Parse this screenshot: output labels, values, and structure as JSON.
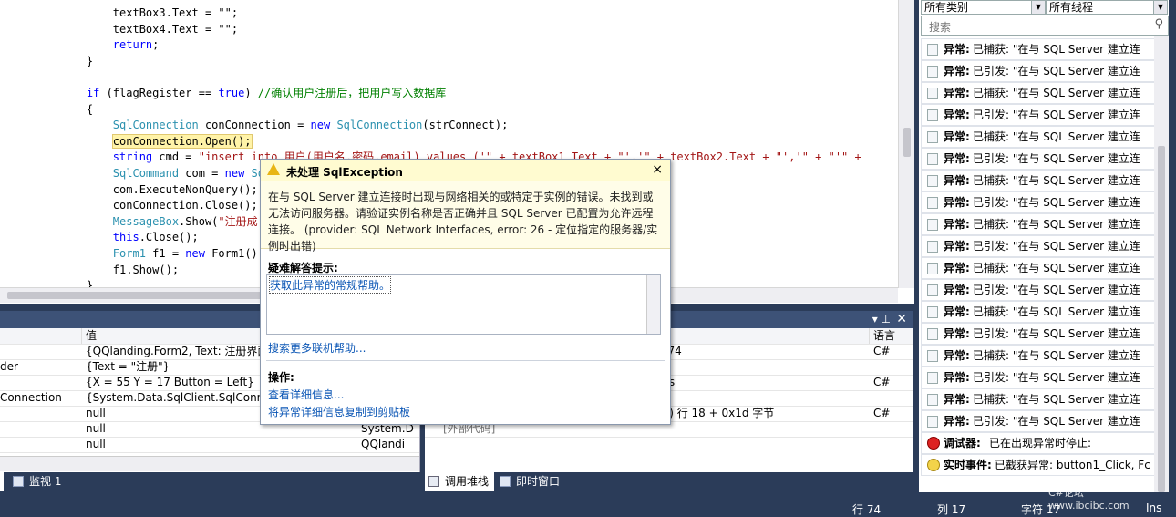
{
  "code": {
    "lines": [
      {
        "indent": "        ",
        "text": "textBox3.Text = \"\";"
      },
      {
        "indent": "        ",
        "text": "textBox4.Text = \"\";"
      },
      {
        "indent": "        ",
        "kw": "return",
        "text": ";"
      },
      {
        "indent": "    ",
        "text": "}"
      },
      {
        "indent": "",
        "text": ""
      },
      {
        "indent": "    ",
        "kw": "if",
        "text": " (flagRegister == ",
        "kw2": "true",
        "text2": ") ",
        "comment": "//确认用户注册后，把用户写入数据库"
      },
      {
        "indent": "    ",
        "text": "{"
      },
      {
        "indent": "        ",
        "type": "SqlConnection",
        "text": " conConnection = ",
        "kw": "new",
        "type2": " SqlConnection",
        "text2": "(strConnect);"
      },
      {
        "indent": "        ",
        "highlight": "conConnection.Open();",
        "text": ""
      },
      {
        "indent": "        ",
        "kw": "string",
        "text": " cmd = ",
        "str": "\"insert into 用户(用户名,密码,email) values ('\" + textBox1.Text + \"','\" + textBox2.Text + \"','\" + \"'\" +"
      },
      {
        "indent": "        ",
        "type": "SqlCommand",
        "text": " com = ",
        "kw": "new",
        "type2": " Sq"
      },
      {
        "indent": "        ",
        "text": "com.ExecuteNonQuery();"
      },
      {
        "indent": "        ",
        "text": "conConnection.Close();"
      },
      {
        "indent": "        ",
        "type": "MessageBox",
        "text": ".Show(",
        "str": "\"注册成"
      },
      {
        "indent": "        ",
        "kw": "this",
        "text": ".Close();"
      },
      {
        "indent": "        ",
        "type": "Form1",
        "text": " f1 = ",
        "kw": "new",
        "text2": " Form1()"
      },
      {
        "indent": "        ",
        "text": "f1.Show();"
      },
      {
        "indent": "    ",
        "text": "}"
      }
    ]
  },
  "watch": {
    "header_value": "值",
    "rows": [
      {
        "name": "",
        "value": "{QQlanding.Form2, Text: 注册界面}",
        "type": ""
      },
      {
        "name": "der",
        "value": "{Text = \"注册\"}",
        "type": ""
      },
      {
        "name": "",
        "value": "{X = 55 Y = 17 Button = Left}",
        "type": ""
      },
      {
        "name": "Connection",
        "value": "{System.Data.SqlClient.SqlConnection}",
        "type": ""
      },
      {
        "name": "",
        "value": "null",
        "type": "string"
      },
      {
        "name": "",
        "value": "null",
        "type": "System.D"
      },
      {
        "name": "",
        "value": "null",
        "type": "QQlandi"
      }
    ],
    "tab_label": "监视 1"
  },
  "callstack": {
    "header_lang": "语言",
    "rows": [
      {
        "text": "k(object sender, System.EventArgs e) 行 74",
        "lang": "C#"
      },
      {
        "text": "",
        "lang": ""
      },
      {
        "text": "nkClicked(object sender, System.Windows",
        "lang": "C#"
      },
      {
        "text": "",
        "lang": ""
      },
      {
        "text": "QQlanding.exe!QQlanding.Program.Main() 行 18 + 0x1d 字节",
        "lang": "C#"
      },
      {
        "text": "[外部代码]",
        "lang": ""
      }
    ],
    "tabs": [
      "调用堆栈",
      "即时窗口"
    ]
  },
  "dialog": {
    "title": "未处理 SqlException",
    "close": "×",
    "message": "在与 SQL Server 建立连接时出现与网络相关的或特定于实例的错误。未找到或无法访问服务器。请验证实例名称是否正确并且 SQL Server 已配置为允许远程连接。 (provider: SQL Network Interfaces, error: 26 - 定位指定的服务器/实例时出错)",
    "tips_title": "疑难解答提示:",
    "tip_link": "获取此异常的常规帮助。",
    "search_link": "搜索更多联机帮助...",
    "actions_title": "操作:",
    "action_details": "查看详细信息...",
    "action_copy": "将异常详细信息复制到剪贴板"
  },
  "events": {
    "filter_category": "所有类别",
    "filter_thread": "所有线程",
    "search_placeholder": "搜索",
    "rows": [
      {
        "label": "异常:",
        "text": "已捕获: \"在与 SQL Server 建立连"
      },
      {
        "label": "异常:",
        "text": "已引发: \"在与 SQL Server 建立连"
      },
      {
        "label": "异常:",
        "text": "已捕获: \"在与 SQL Server 建立连"
      },
      {
        "label": "异常:",
        "text": "已引发: \"在与 SQL Server 建立连"
      },
      {
        "label": "异常:",
        "text": "已捕获: \"在与 SQL Server 建立连"
      },
      {
        "label": "异常:",
        "text": "已引发: \"在与 SQL Server 建立连"
      },
      {
        "label": "异常:",
        "text": "已捕获: \"在与 SQL Server 建立连"
      },
      {
        "label": "异常:",
        "text": "已引发: \"在与 SQL Server 建立连"
      },
      {
        "label": "异常:",
        "text": "已捕获: \"在与 SQL Server 建立连"
      },
      {
        "label": "异常:",
        "text": "已引发: \"在与 SQL Server 建立连"
      },
      {
        "label": "异常:",
        "text": "已捕获: \"在与 SQL Server 建立连"
      },
      {
        "label": "异常:",
        "text": "已引发: \"在与 SQL Server 建立连"
      },
      {
        "label": "异常:",
        "text": "已捕获: \"在与 SQL Server 建立连"
      },
      {
        "label": "异常:",
        "text": "已引发: \"在与 SQL Server 建立连"
      },
      {
        "label": "异常:",
        "text": "已捕获: \"在与 SQL Server 建立连"
      },
      {
        "label": "异常:",
        "text": "已引发: \"在与 SQL Server 建立连"
      },
      {
        "label": "异常:",
        "text": "已捕获: \"在与 SQL Server 建立连"
      },
      {
        "label": "异常:",
        "text": "已引发: \"在与 SQL Server 建立连"
      },
      {
        "label": "异常:",
        "text": "已捕获: \"在与 SQL Server 建立连"
      }
    ],
    "debugger_label": "调试器:",
    "debugger_text": "已在出现异常时停止:",
    "live_label": "实时事件:",
    "live_text": "已截获异常: button1_Click, Fc"
  },
  "status": {
    "line": "行 74",
    "col": "列 17",
    "char": "字符 17",
    "ins": "Ins"
  },
  "watermark": "C#论坛 www.ibcibc.com",
  "colors": {
    "accent": "#2b3c59",
    "link": "#0b56b5"
  }
}
